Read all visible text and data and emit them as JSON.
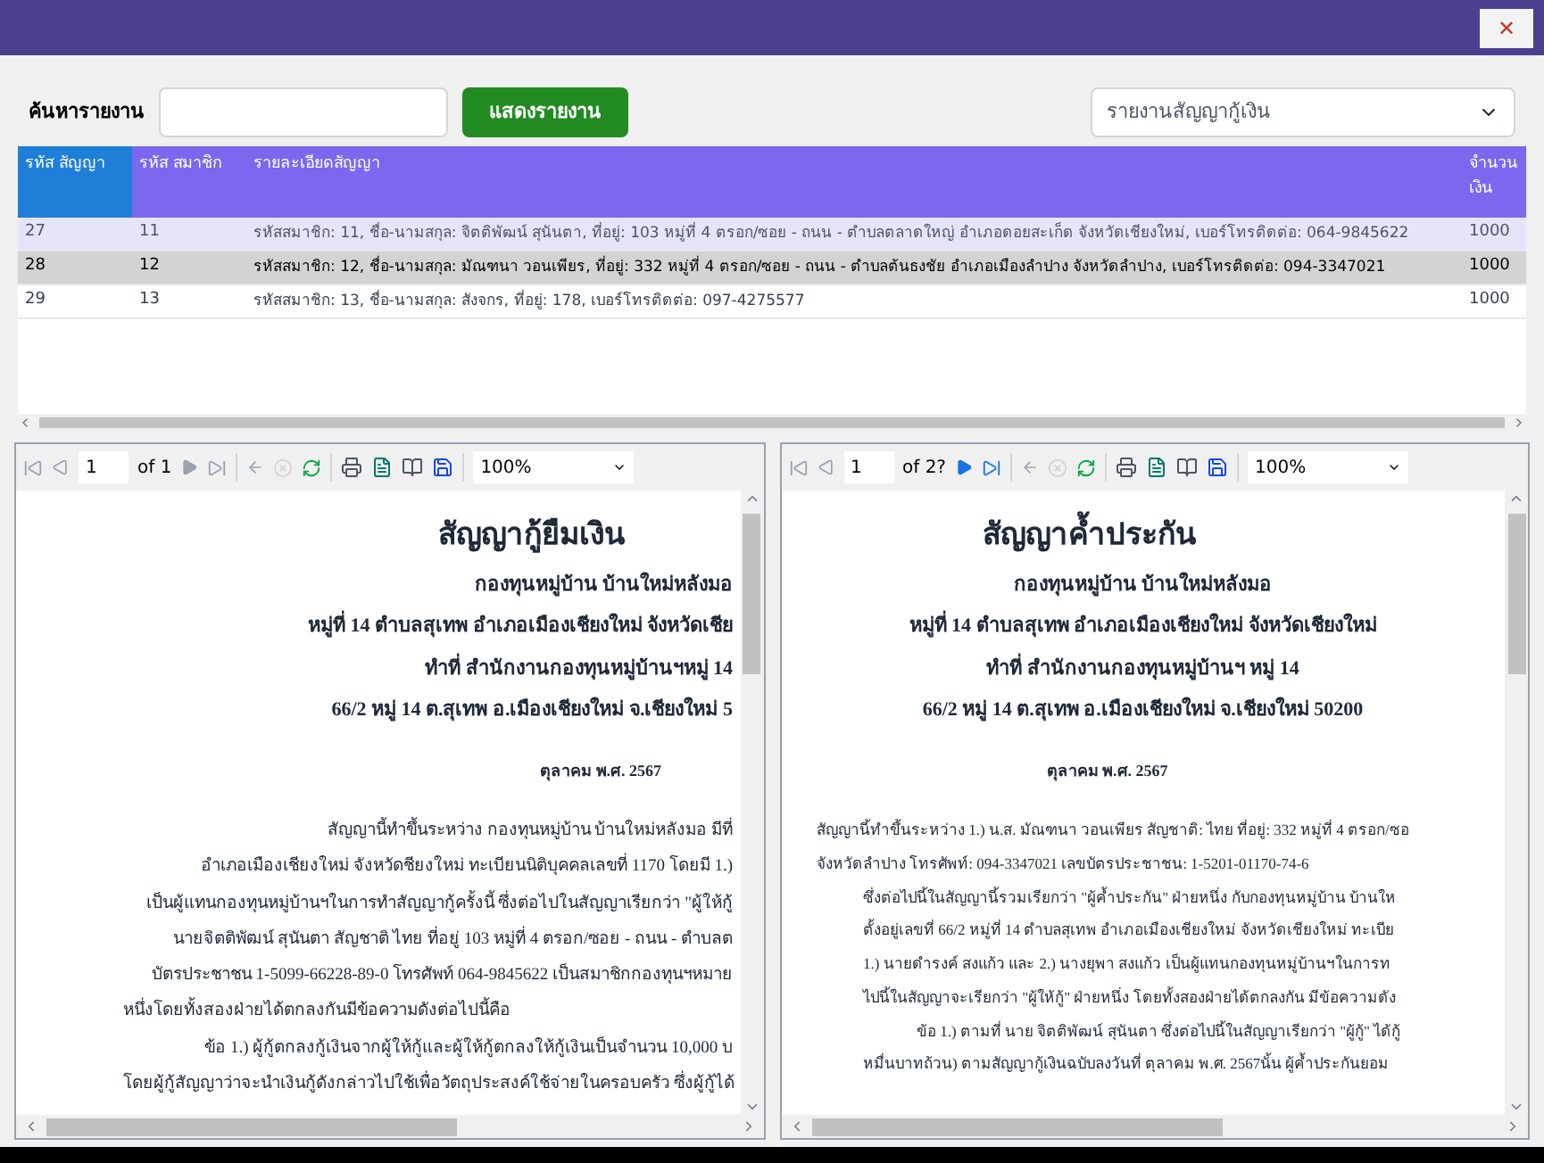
{
  "window": {
    "close": "✕"
  },
  "search": {
    "label": "ค้นหารายงาน",
    "button": "แสดงรายงาน",
    "report_select": "รายงานสัญญากู้เงิน"
  },
  "table": {
    "columns": [
      "รหัส สัญญา",
      "รหัส สมาชิก",
      "รายละเอียดสัญญา",
      "จำนวน เงิน"
    ],
    "rows": [
      {
        "cells": [
          "27",
          "11",
          "รหัสสมาชิก: 11, ชื่อ-นามสกุล: จิตติพัฒน์ สุนันตา, ที่อยู่:  103  หมู่ที่ 4 ตรอก/ซอย - ถนน -  ตำบลตลาดใหญ่  อำเภอดอยสะเก็ด  จังหวัดเชียงใหม่, เบอร์โทรติดต่อ: 064-9845622",
          "1000"
        ],
        "selected": false,
        "hovered": true
      },
      {
        "cells": [
          "28",
          "12",
          "รหัสสมาชิก: 12, ชื่อ-นามสกุล: มัณฑนา วอนเพียร, ที่อยู่:  332  หมู่ที่ 4 ตรอก/ซอย - ถนน -  ตำบลต้นธงชัย  อำเภอเมืองลำปาง  จังหวัดลำปาง, เบอร์โทรติดต่อ: 094-3347021",
          "1000"
        ],
        "selected": true,
        "hovered": false
      },
      {
        "cells": [
          "29",
          "13",
          "รหัสสมาชิก: 13, ชื่อ-นามสกุล: สังจกร, ที่อยู่: 178, เบอร์โทรติดต่อ: 097-4275577",
          "1000"
        ],
        "selected": false,
        "hovered": false
      }
    ]
  },
  "viewers": [
    {
      "page": "1",
      "of": "of 1",
      "next_enabled": false,
      "zoom": "100%",
      "kind": "clipped",
      "heading": [
        "สัญญากู้ยืมเงิน",
        "กองทุนหมู่บ้าน บ้านใหม่หลังมอ",
        "หมู่ที่ 14 ตำบลสุเทพ อำเภอเมืองเชียงใหม่ จังหวัดเชีย",
        "ทำที่ สำนักงานกองทุนหมู่บ้านฯหมู่ 14",
        "66/2 หมู่ 14 ต.สุเทพ อ.เมืองเชียงใหม่ จ.เชียงใหม่ 5"
      ],
      "date": "ตุลาคม พ.ศ. 2567",
      "lines": [
        {
          "kind": "plain",
          "text": "สัญญานี้ทำขึ้นระหว่าง กองทุนหมู่บ้าน บ้านใหม่หลังมอ มีที่"
        },
        {
          "kind": "plain",
          "text": "อำเภอเมืองเชียงใหม่ จังหวัดชียงใหม่ ทะเบียนนิติบุคคลเลขที่ 1170 โดยมี 1.)"
        },
        {
          "kind": "plain",
          "text": "เป็นผู้แทนกองทุนหมู่บ้านฯในการทำสัญญากู้ครั้งนี้ ซึ่งต่อไปในสัญญาเรียกว่า \"ผู้ให้กู้"
        },
        {
          "kind": "plain",
          "text": "นายจิตติพัฒน์ สุนันตา สัญชาติ ไทย ที่อยู่  103  หมู่ที่ 4 ตรอก/ซอย - ถนน -  ตำบลต"
        },
        {
          "kind": "plain",
          "text": "บัตรประชาชน 1-5099-66228-89-0 โทรศัพท์ 064-9845622 เป็นสมาชิกกองทุนฯหมาย"
        },
        {
          "kind": "indent",
          "text": "หนึ่งโดยทั้งสองฝ่ายได้ตกลงกันมีข้อความดังต่อไปนี้คือ"
        },
        {
          "kind": "plain",
          "text": "ข้อ 1.) ผู้กู้ตกลงกู้เงินจากผู้ให้กู้และผู้ให้กู้ตกลงให้กู้เงินเป็นจำนวน 10,000 บ"
        },
        {
          "kind": "indent",
          "text": "โดยผู้กู้สัญญาว่าจะนำเงินกู้ดังกล่าวไปใช้เพื่อวัตถุประสงค์ใช้จ่ายในครอบครัว ซึ่งผู้กู้ได้"
        }
      ]
    },
    {
      "page": "1",
      "of": "of 2?",
      "next_enabled": true,
      "zoom": "100%",
      "kind": "centered",
      "heading": [
        "สัญญาค้ำประกัน",
        "กองทุนหมู่บ้าน บ้านใหม่หลังมอ",
        "หมู่ที่ 14 ตำบลสุเทพ อำเภอเมืองเชียงใหม่ จังหวัดเชียงใหม่",
        "ทำที่ สำนักงานกองทุนหมู่บ้านฯ หมู่ 14",
        "66/2 หมู่ 14 ต.สุเทพ อ.เมืองเชียงใหม่  จ.เชียงใหม่ 50200"
      ],
      "date": "ตุลาคม พ.ศ. 2567",
      "lines": [
        {
          "kind": "plain",
          "text": "สัญญานี้ทำขึ้นระหว่าง  1.) น.ส. มัณฑนา วอนเพียร สัญชาติ: ไทย ที่อยู่:  332  หมู่ที่ 4 ตรอก/ซอ"
        },
        {
          "kind": "plain",
          "text": "จังหวัดลำปาง โทรศัพท์: 094-3347021 เลขบัตรประชาชน: 1-5201-01170-74-6"
        },
        {
          "kind": "indent",
          "text": "ซึ่งต่อไปนี้ในสัญญานี้รวมเรียกว่า \"ผู้ค้ำประกัน\" ฝ่ายหนึ่ง กับกองทุนหมู่บ้าน บ้านให"
        },
        {
          "kind": "indent",
          "text": "ตั้งอยู่เลขที่  66/2 หมู่ที่ 14 ตำบลสุเทพ อำเภอเมืองเชียงใหม่ จังหวัดเชียงใหม่ ทะเบีย"
        },
        {
          "kind": "indent",
          "text": "1.) นายดำรงค์  สงแก้ว และ 2.) นางยุพา  สงแก้ว เป็นผู้แทนกองทุนหมู่บ้านฯในการท"
        },
        {
          "kind": "indent",
          "text": "ไปนี้ในสัญญาจะเรียกว่า \"ผู้ให้กู้\" ฝ่ายหนึ่ง โดยทั้งสองฝ่ายได้ตกลงกัน มีข้อความดัง"
        },
        {
          "kind": "deep",
          "text": "ข้อ 1.) ตามที่ นาย จิตติพัฒน์ สุนันตา ซึ่งต่อไปนี้ในสัญญาเรียกว่า \"ผู้กู้\" ได้กู้"
        },
        {
          "kind": "indent",
          "text": "หมื่นบาทถ้วน) ตามสัญญากู้เงินฉบับลงวันที่  ตุลาคม พ.ศ. 2567นั้น ผู้ค้ำประกันยอม"
        }
      ]
    }
  ]
}
